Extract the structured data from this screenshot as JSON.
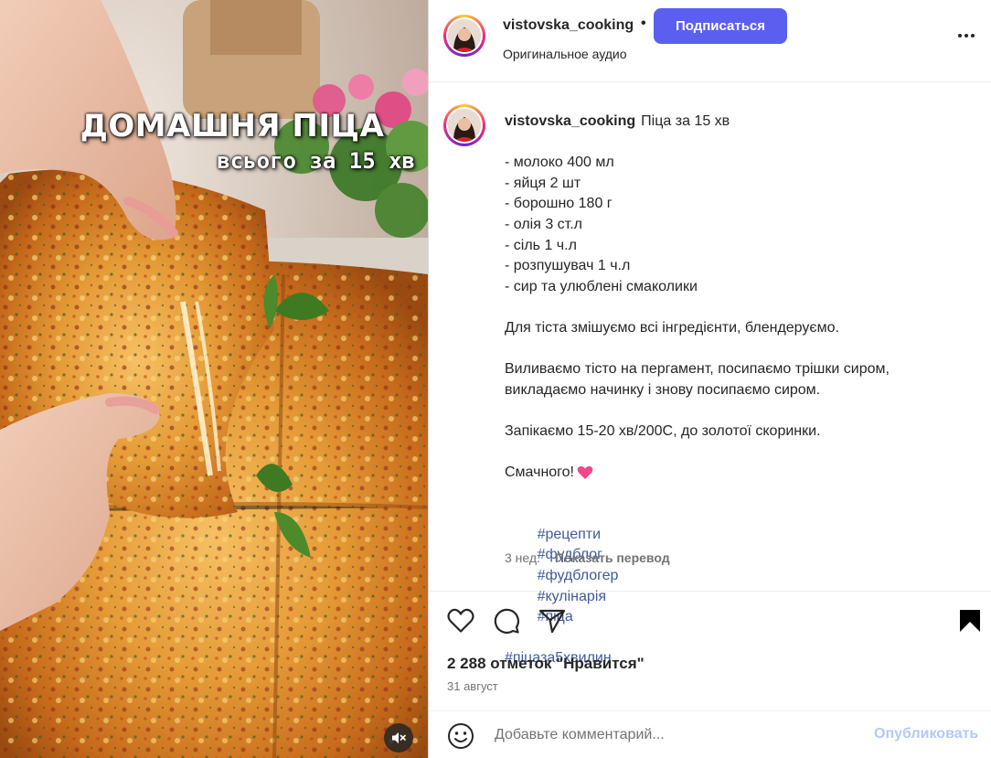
{
  "media": {
    "overlay_title": "ДОМАШНЯ ПІЦА",
    "overlay_subtitle": "всього за 15 хв",
    "mute_icon": "speaker-muted-icon"
  },
  "header": {
    "username": "vistovska_cooking",
    "separator": "•",
    "follow_label": "Подписаться",
    "audio_label": "Оригинальное аудио",
    "more_icon": "more-options-icon"
  },
  "caption": {
    "username": "vistovska_cooking",
    "title": "Піца за 15 хв",
    "ingredients": [
      "- молоко 400 мл",
      "- яйця 2 шт",
      "- борошно 180 г",
      "- олія 3 ст.л",
      "- сіль 1 ч.л",
      "- розпушувач 1 ч.л",
      "- сир та улюблені смаколики"
    ],
    "step1": "Для тіста змішуємо всі інгредієнти, блендеруємо.",
    "step2_line1": "Виливаємо тісто на пергамент, посипаємо трішки сиром,",
    "step2_line2": "викладаємо начинку і знову посипаємо сиром.",
    "step3": "Запікаємо 15-20 хв/200С, до золотої скоринки.",
    "closing": "Смачного!",
    "closing_emoji": "heart-emoji",
    "hashtags_line1": [
      "#рецепти",
      "#фудблог",
      "#фудблогер",
      "#кулінарія",
      "#піца"
    ],
    "hashtags_line2": [
      "#піцаза5хвилин"
    ],
    "time_ago": "3 нед.",
    "translate_label": "Показать перевод"
  },
  "actions": {
    "likes_text": "2 288 отметок \"Нравится\"",
    "date_text": "31 август"
  },
  "comment": {
    "placeholder": "Добавьте комментарий...",
    "publish_label": "Опубликовать"
  },
  "colors": {
    "follow_button": "#5b5ff0",
    "hashtag": "#3f5a9b",
    "publish_disabled": "#b2c9f7",
    "secondary_text": "#737373"
  }
}
